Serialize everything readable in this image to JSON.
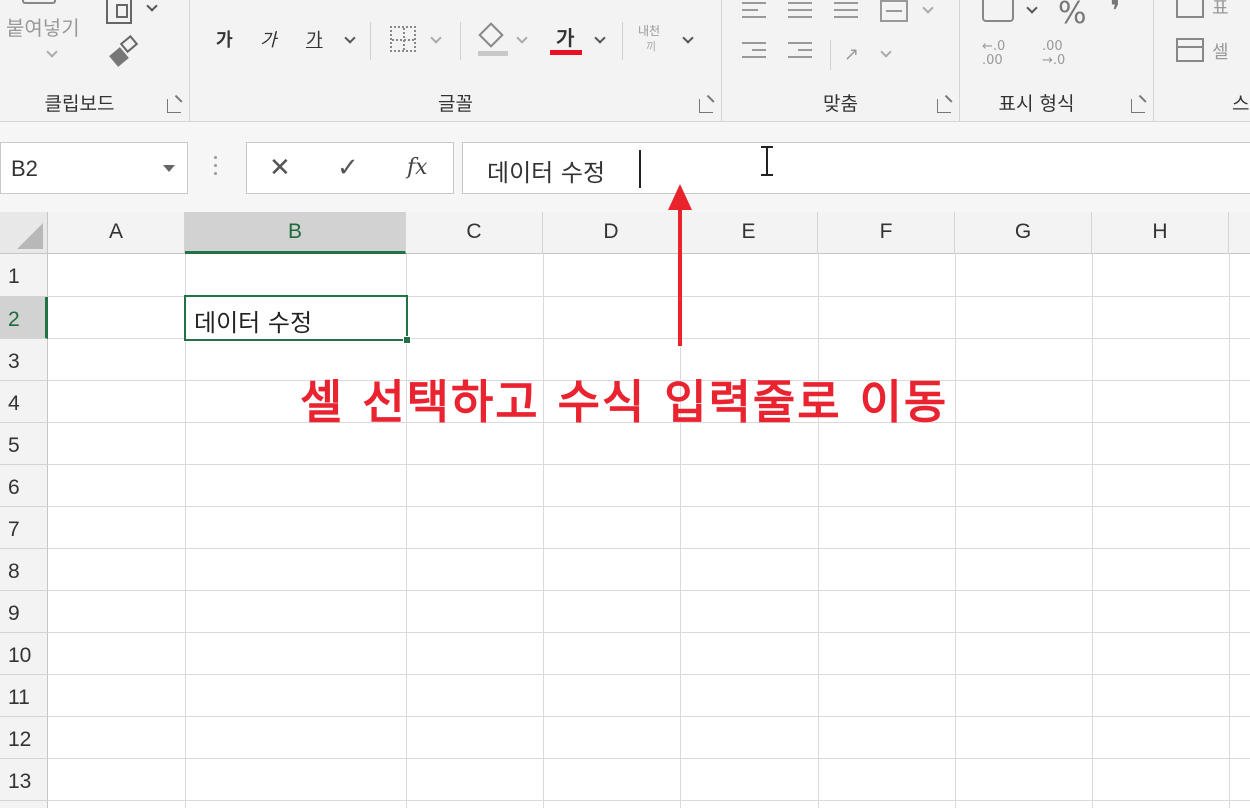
{
  "ribbon": {
    "clipboard": {
      "label": "클립보드",
      "paste_label": "붙여넣기"
    },
    "font": {
      "label": "글꼴",
      "bold_label": "가",
      "italic_label": "가",
      "underline_label": "가",
      "font_color_label": "가",
      "font_color": "#e81123",
      "phonetic_label_top": "내천",
      "phonetic_label_bottom": "끼"
    },
    "alignment": {
      "label": "맞춤"
    },
    "number": {
      "label": "표시 형식",
      "percent_label": "%",
      "comma_label": "❜",
      "increase_decimal": "←.0\n.00",
      "decrease_decimal": ".00\n→.0"
    },
    "styles": {
      "partial_label_1": "표",
      "partial_label_2": "셀",
      "partial_label_3": "스"
    }
  },
  "formula_bar": {
    "name_box": "B2",
    "cancel_label": "✕",
    "enter_label": "✓",
    "fx_label": "fx",
    "content": "데이터 수정"
  },
  "grid": {
    "columns": [
      "A",
      "B",
      "C",
      "D",
      "E",
      "F",
      "G",
      "H"
    ],
    "rows": [
      "1",
      "2",
      "3",
      "4",
      "5",
      "6",
      "7",
      "8",
      "9",
      "10",
      "11",
      "12",
      "13"
    ],
    "selected_cell": "B2",
    "selected_column": "B",
    "selected_row": "2",
    "cell_b2_value": "데이터 수정",
    "accent_color": "#217346"
  },
  "annotation": {
    "text": "셀 선택하고 수식 입력줄로 이동",
    "color": "#ea2330"
  }
}
